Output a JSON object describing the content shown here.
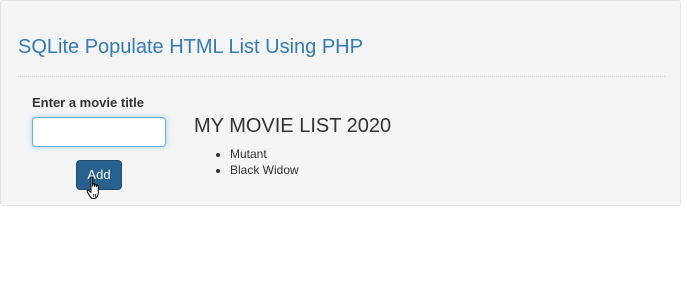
{
  "header": {
    "title": "SQLite Populate HTML List Using PHP"
  },
  "form": {
    "label": "Enter a movie title",
    "input_value": "",
    "input_placeholder": "",
    "add_label": "Add"
  },
  "movies": {
    "heading": "MY MOVIE LIST 2020",
    "items": [
      "Mutant",
      "Black Widow"
    ]
  },
  "colors": {
    "title_blue": "#337ab7",
    "button_blue": "#286090",
    "panel_bg": "#f5f5f5",
    "input_focus": "#66afe9"
  },
  "icons": {
    "cursor": "hand-pointer-icon"
  }
}
